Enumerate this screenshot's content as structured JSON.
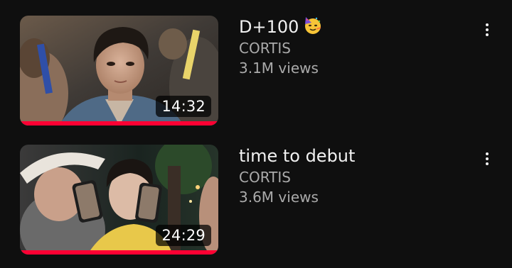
{
  "videos": [
    {
      "title": "D+100",
      "title_emoji": "partying-face-icon",
      "channel": "CORTIS",
      "views": "3.1M views",
      "duration": "14:32",
      "watch_progress": 1.0
    },
    {
      "title": "time to debut",
      "channel": "CORTIS",
      "views": "3.6M views",
      "duration": "24:29",
      "watch_progress": 1.0
    }
  ],
  "colors": {
    "background": "#0f0f0f",
    "progress": "#ff0033",
    "title": "#f1f1f1",
    "secondary": "#aaaaaa"
  }
}
